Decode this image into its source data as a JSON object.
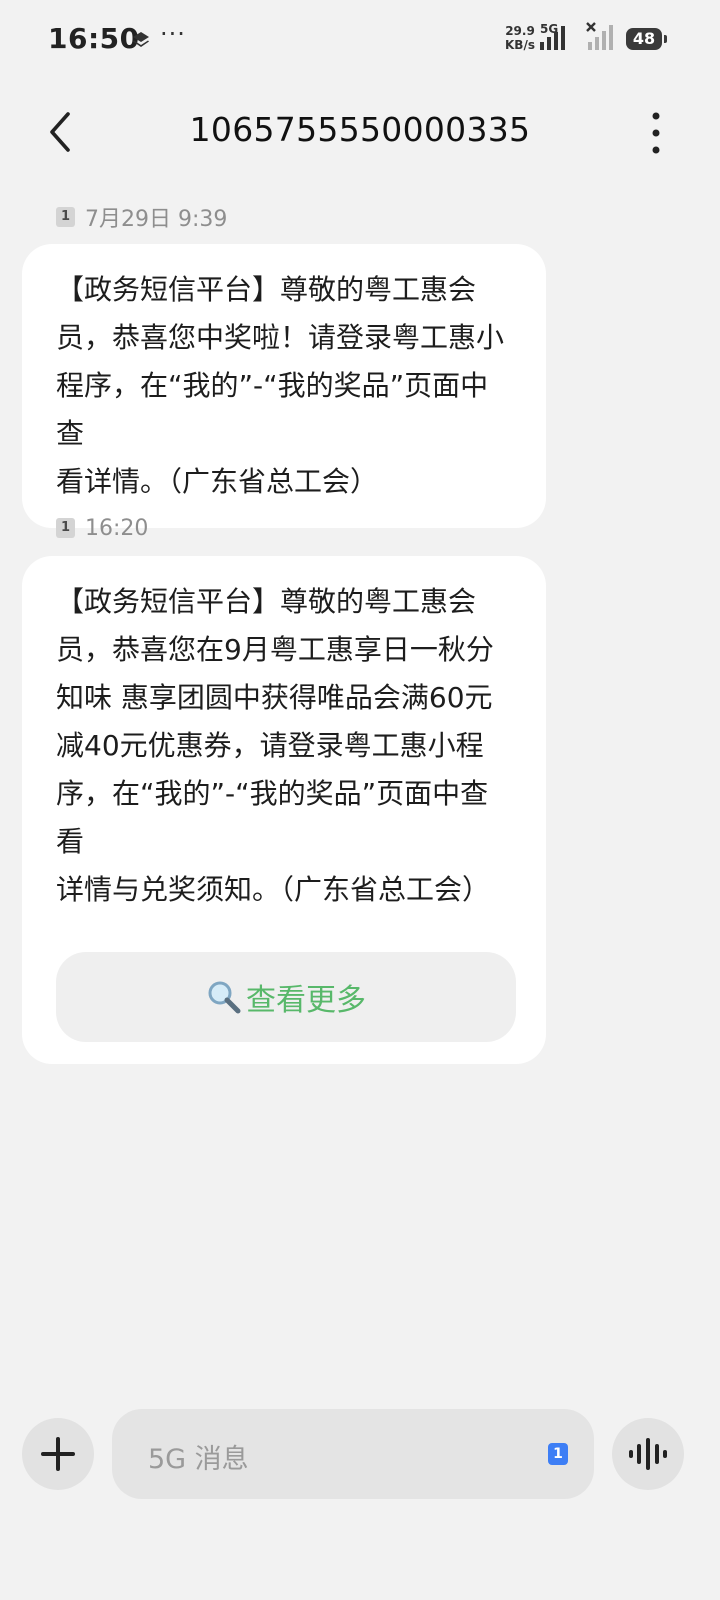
{
  "status_bar": {
    "time": "16:50",
    "dots": "···",
    "speed_value": "29.9",
    "speed_unit": "KB/s",
    "network": "5G",
    "battery": "48"
  },
  "header": {
    "title": "1065755550000335"
  },
  "messages": [
    {
      "sim": "1",
      "time": "7月29日 9:39",
      "text": "【政务短信平台】尊敬的粤工惠会\n员，恭喜您中奖啦！请登录粤工惠小\n程序，在“我的”-“我的奖品”页面中查\n看详情。（广东省总工会）"
    },
    {
      "sim": "1",
      "time": "16:20",
      "text": "【政务短信平台】尊敬的粤工惠会\n员，恭喜您在9月粤工惠享日一秋分\n知味 惠享团圆中获得唯品会满60元\n减40元优惠券，请登录粤工惠小程\n序，在“我的”-“我的奖品”页面中查看\n详情与兑奖须知。（广东省总工会）",
      "action_label": "查看更多"
    }
  ],
  "composer": {
    "placeholder": "5G 消息",
    "sim": "1"
  },
  "colors": {
    "background": "#f2f2f2",
    "bubble": "#ffffff",
    "action_text": "#58b86a",
    "sim_select": "#3d7ef5"
  }
}
